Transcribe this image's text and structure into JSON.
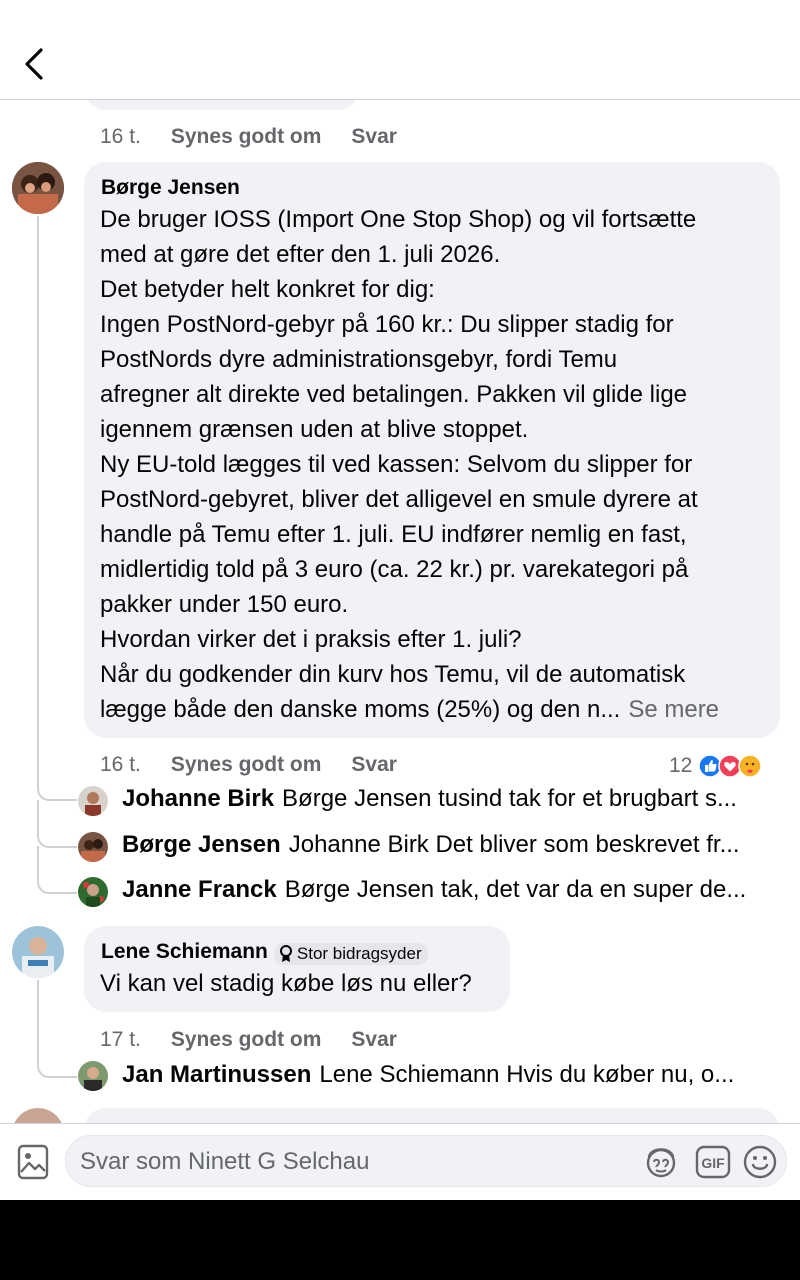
{
  "header": {
    "back_label": "Tilbage"
  },
  "comment_main": {
    "prev_time": "16 t.",
    "prev_like": "Synes godt om",
    "prev_reply": "Svar",
    "author": "Børge Jensen",
    "lines": [
      "De bruger IOSS (Import One Stop Shop) og vil fortsætte",
      "med at gøre det efter den 1. juli 2026.",
      "Det betyder helt konkret for dig:",
      "Ingen PostNord-gebyr på 160 kr.: Du slipper stadig for",
      "PostNords dyre administrationsgebyr, fordi Temu",
      "afregner alt direkte ved betalingen. Pakken vil glide lige",
      "igennem grænsen uden at blive stoppet.",
      "Ny EU-told lægges til ved kassen: Selvom du slipper for",
      "PostNord-gebyret, bliver det alligevel en smule dyrere at",
      "handle på Temu efter 1. juli. EU indfører nemlig en fast,",
      "midlertidig told på 3 euro (ca. 22 kr.) pr. varekategori på",
      "pakker under 150 euro.",
      "Hvordan virker det i praksis efter 1. juli?",
      "Når du godkender din kurv hos Temu, vil de automatisk",
      "lægge både den danske moms (25%) og den n..."
    ],
    "see_more": "Se mere",
    "time": "16 t.",
    "like": "Synes godt om",
    "reply": "Svar",
    "reaction_count": "12",
    "reactions": [
      "like-icon",
      "love-icon",
      "care-icon"
    ],
    "replies": [
      {
        "name": "Johanne Birk",
        "text": "Børge Jensen tusind tak for et brugbart s..."
      },
      {
        "name": "Børge Jensen",
        "text": "Johanne Birk Det bliver som beskrevet fr..."
      },
      {
        "name": "Janne Franck",
        "text": "Børge Jensen tak, det var da en super de..."
      }
    ]
  },
  "comment_second": {
    "author": "Lene Schiemann",
    "badge": "Stor bidragsyder",
    "text": "Vi kan vel stadig købe løs nu eller?",
    "time": "17 t.",
    "like": "Synes godt om",
    "reply": "Svar",
    "replies": [
      {
        "name": "Jan Martinussen",
        "text": "Lene Schiemann  Hvis du køber nu, o..."
      }
    ]
  },
  "composer": {
    "placeholder": "Svar som Ninett G Selchau"
  },
  "colors": {
    "bubble": "#f0f2f5",
    "meta": "#65676b",
    "like_blue": "#1877f2",
    "love_red": "#f33e58",
    "care_yellow": "#f7b125"
  }
}
